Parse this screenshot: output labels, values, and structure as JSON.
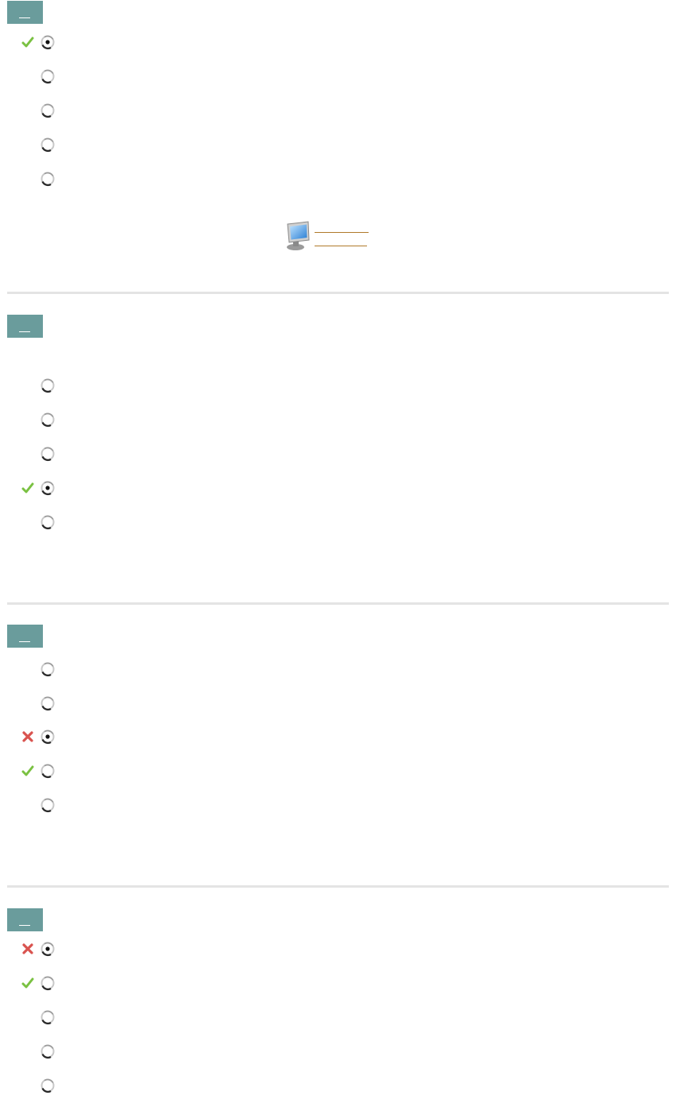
{
  "colors": {
    "badge": "#6a9c9c",
    "divider": "#e4e4e4",
    "check": "#7ac142",
    "cross": "#d9534f",
    "link": "#b07a2a"
  },
  "help_link": {
    "icon": "monitor-icon",
    "line1": "",
    "line2": ""
  },
  "questions": [
    {
      "number": "",
      "options": [
        {
          "label": "",
          "selected": true,
          "mark": "check"
        },
        {
          "label": "",
          "selected": false,
          "mark": ""
        },
        {
          "label": "",
          "selected": false,
          "mark": ""
        },
        {
          "label": "",
          "selected": false,
          "mark": ""
        },
        {
          "label": "",
          "selected": false,
          "mark": ""
        }
      ]
    },
    {
      "number": "",
      "options": [
        {
          "label": "",
          "selected": false,
          "mark": ""
        },
        {
          "label": "",
          "selected": false,
          "mark": ""
        },
        {
          "label": "",
          "selected": false,
          "mark": ""
        },
        {
          "label": "",
          "selected": true,
          "mark": "check"
        },
        {
          "label": "",
          "selected": false,
          "mark": ""
        }
      ]
    },
    {
      "number": "",
      "options": [
        {
          "label": "",
          "selected": false,
          "mark": ""
        },
        {
          "label": "",
          "selected": false,
          "mark": ""
        },
        {
          "label": "",
          "selected": true,
          "mark": "cross"
        },
        {
          "label": "",
          "selected": false,
          "mark": "check"
        },
        {
          "label": "",
          "selected": false,
          "mark": ""
        }
      ]
    },
    {
      "number": "",
      "options": [
        {
          "label": "",
          "selected": true,
          "mark": "cross"
        },
        {
          "label": "",
          "selected": false,
          "mark": "check"
        },
        {
          "label": "",
          "selected": false,
          "mark": ""
        },
        {
          "label": "",
          "selected": false,
          "mark": ""
        },
        {
          "label": "",
          "selected": false,
          "mark": ""
        }
      ]
    }
  ]
}
